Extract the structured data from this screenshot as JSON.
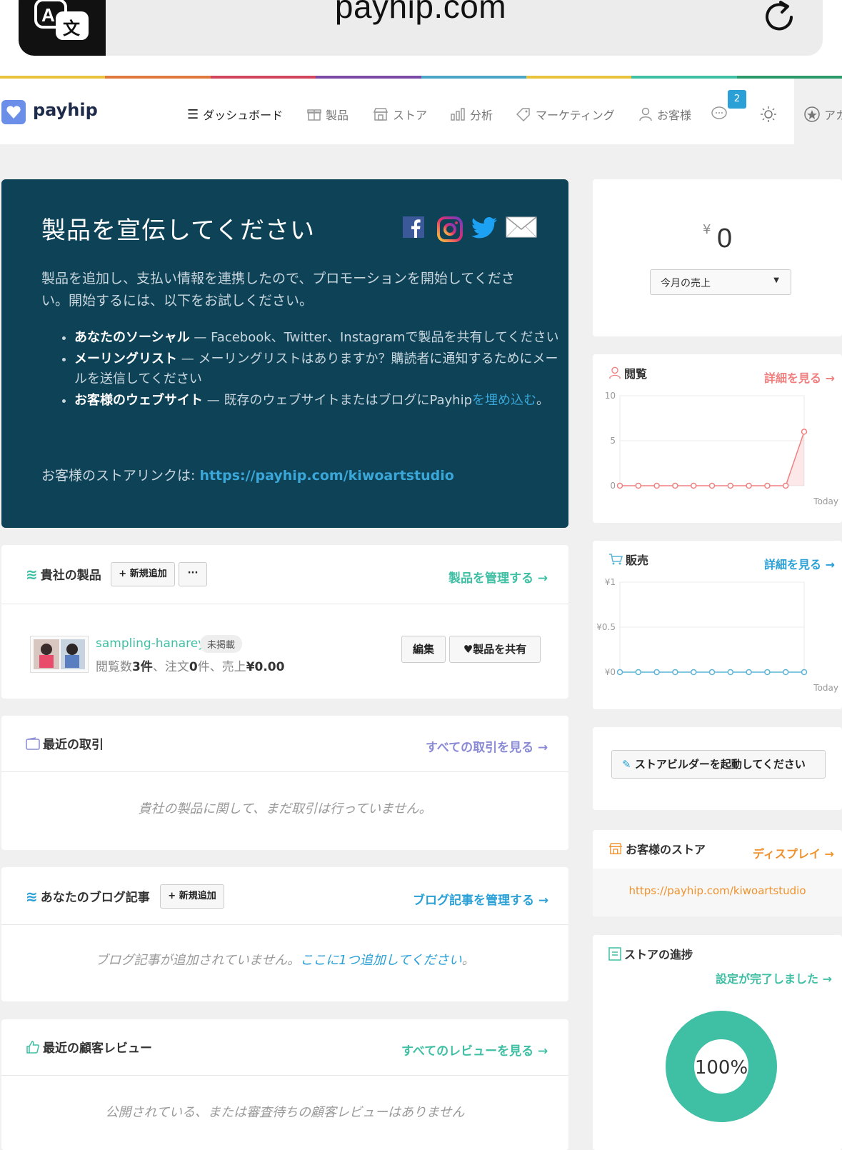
{
  "browser": {
    "url": "payhip.com"
  },
  "nav": {
    "brand": "payhip",
    "items": [
      {
        "label": "ダッシュボード",
        "icon": "menu-icon",
        "active": true
      },
      {
        "label": "製品",
        "icon": "gift-icon"
      },
      {
        "label": "ストア",
        "icon": "store-icon"
      },
      {
        "label": "分析",
        "icon": "chart-icon"
      },
      {
        "label": "マーケティング",
        "icon": "tag-icon"
      },
      {
        "label": "お客様",
        "icon": "user-icon"
      }
    ],
    "chat_badge": "2",
    "account_label": "アカ"
  },
  "promo": {
    "title": "製品を宣伝してください",
    "intro": "製品を追加し、支払い情報を連携したので、プロモーションを開始してください。開始するには、以下をお試しください。",
    "bullets": [
      {
        "bold": "あなたのソーシャル",
        "text": " — Facebook、Twitter、Instagramで製品を共有してください"
      },
      {
        "bold": "メーリングリスト",
        "text": " — メーリングリストはありますか？購読者に通知するためにメールを送信してください"
      },
      {
        "bold": "お客様のウェブサイト",
        "text": " — 既存のウェブサイトまたはブログにPayhip",
        "link": "を埋め込む",
        "tail": "。"
      }
    ],
    "store_prefix": "お客様のストアリンクは: ",
    "store_url": "https://payhip.com/kiwoartstudio"
  },
  "products": {
    "title": "貴社の製品",
    "add_label": "+ 新規追加",
    "more_label": "···",
    "manage_link": "製品を管理する →",
    "item": {
      "name": "sampling-hanarey",
      "status": "未掲載",
      "views_prefix": "閲覧数",
      "views": "3件",
      "orders_prefix": "、注文",
      "orders": "0",
      "orders_suffix": "件、売上",
      "sales": "¥0.00",
      "edit_label": "編集",
      "share_label": "♥製品を共有"
    }
  },
  "transactions": {
    "title": "最近の取引",
    "link": "すべての取引を見る →",
    "empty": "貴社の製品に関して、まだ取引は行っていません。"
  },
  "blog": {
    "title": "あなたのブログ記事",
    "add_label": "+ 新規追加",
    "link": "ブログ記事を管理する →",
    "empty": "ブログ記事が追加されていません。",
    "empty_link": "ここに1つ追加してください",
    "empty_tail": "。"
  },
  "reviews": {
    "title": "最近の顧客レビュー",
    "link": "すべてのレビューを見る →",
    "empty": "公開されている、または審査待ちの顧客レビューはありません"
  },
  "revenue": {
    "currency": "¥",
    "amount": "0",
    "select": "今月の売上"
  },
  "views_chart": {
    "title": "閲覧",
    "link": "詳細を見る →",
    "today": "Today",
    "color": "#f08080"
  },
  "sales_chart": {
    "title": "販売",
    "link": "詳細を見る →",
    "today": "Today",
    "color": "#5ab4d6"
  },
  "chart_data": [
    {
      "type": "area",
      "title": "閲覧",
      "y_ticks": [
        "10",
        "5",
        "0"
      ],
      "ylim": [
        0,
        10
      ],
      "x_end_label": "Today",
      "values": [
        0,
        0,
        0,
        0,
        0,
        0,
        0,
        0,
        0,
        0,
        6
      ]
    },
    {
      "type": "line",
      "title": "販売",
      "y_ticks": [
        "¥1",
        "¥0.5",
        "¥0"
      ],
      "ylim": [
        0,
        1
      ],
      "x_end_label": "Today",
      "values": [
        0,
        0,
        0,
        0,
        0,
        0,
        0,
        0,
        0,
        0,
        0
      ]
    }
  ],
  "storebuilder": {
    "label": "ストアビルダーを起動してください"
  },
  "customer_store": {
    "title": "お客様のストア",
    "link": "ディスプレイ →",
    "url": "https://payhip.com/kiwoartstudio"
  },
  "progress": {
    "title": "ストアの進捗",
    "link": "設定が完了しました →",
    "percent_label": "100%",
    "percent": 100,
    "color": "#3fbfa3"
  }
}
